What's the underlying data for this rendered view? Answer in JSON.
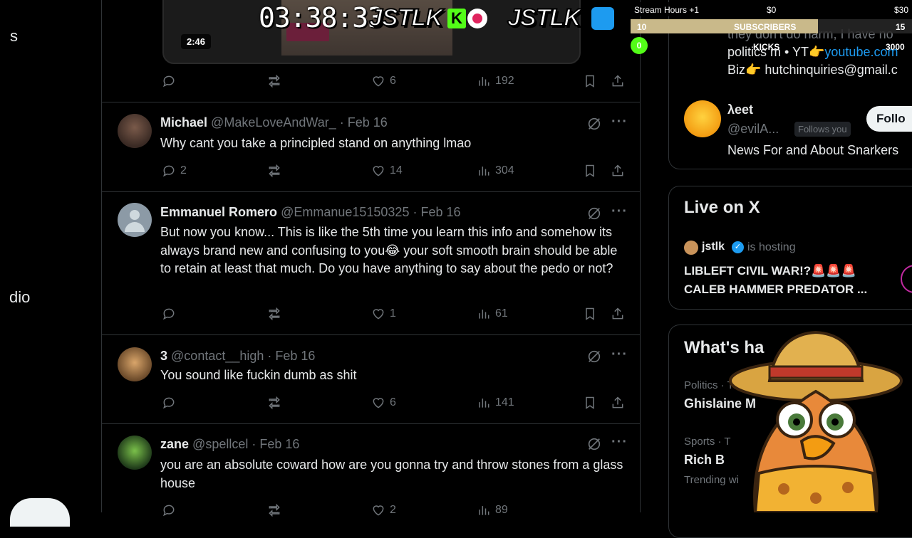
{
  "left_nav": {
    "frag_top": "s",
    "frag_mid": "dio"
  },
  "video": {
    "duration": "2:46"
  },
  "first_actions": {
    "likes": "6",
    "views": "192"
  },
  "tweets": [
    {
      "name": "Michael",
      "handle": "@MakeLoveAndWar_ · Feb 16",
      "text": "Why cant you take a principled stand on anything lmao",
      "replies": "2",
      "likes": "14",
      "views": "304"
    },
    {
      "name": "Emmanuel Romero",
      "handle": "@Emmanue15150325 · Feb 16",
      "text": "But now you know... This is like the 5th time you learn this info and somehow its always brand new and confusing to you😂 your soft smooth brain should be able to retain at least that much. Do you have anything to say about the pedo or not?",
      "replies": "",
      "likes": "1",
      "views": "61"
    },
    {
      "name": "3",
      "handle": "@contact__high · Feb 16",
      "text": "You sound like fuckin dumb as shit",
      "replies": "",
      "likes": "6",
      "views": "141"
    },
    {
      "name": "zane",
      "handle": "@spellcel · Feb 16",
      "text": "you are an absolute coward how are you gonna try and throw stones from a glass house",
      "replies": "",
      "likes": "2",
      "views": "89"
    }
  ],
  "right": {
    "bio_line1": "they don't do harm, I have no",
    "bio_line2_prefix": "politics m • YT👉",
    "bio_line2_link": "youtube.com",
    "bio_line3": "Biz👉 hutchinquiries@gmail.c",
    "suggest": {
      "name": "λeet",
      "handle": "@evilA...",
      "follows_you": "Follows you",
      "bio": "News For and About Snarkers",
      "follow_label": "Follo"
    },
    "live": {
      "title": "Live on X",
      "host": "jstlk",
      "hosting": "is hosting",
      "stream_title_1": "LIBLEFT CIVIL WAR!?🚨🚨🚨",
      "stream_title_2": "CALEB HAMMER PREDATOR ..."
    },
    "happening": {
      "title": "What's ha",
      "items": [
        {
          "context": "Politics · Tren",
          "headline": "Ghislaine M"
        },
        {
          "context": "Sports · T",
          "headline": "Rich B",
          "trend": "Trending wi"
        }
      ]
    }
  },
  "overlay": {
    "clock": "03:38:33",
    "logo1": "JSTLK",
    "logo2": "JSTLK",
    "stream_hours": "Stream Hours +1",
    "money_now": "$0",
    "money_goal": "$30",
    "subs_label": "SUBSCRIBERS",
    "subs_now": "10",
    "subs_goal": "15",
    "kicks_label": "KICKS",
    "kicks_now": "0",
    "kicks_goal": "3000"
  },
  "colors": {
    "accent": "#1d9bf0",
    "kick_green": "#53fc18",
    "bar_gold": "#c9b98a"
  }
}
